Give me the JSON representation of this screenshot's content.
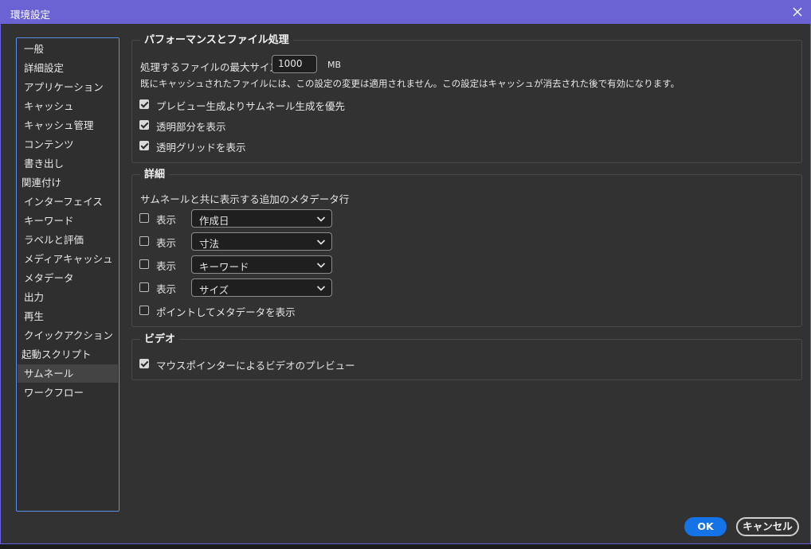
{
  "window": {
    "title": "環境設定"
  },
  "sidebar": {
    "items": [
      {
        "label": "一般"
      },
      {
        "label": "詳細設定"
      },
      {
        "label": "アプリケーション"
      },
      {
        "label": "キャッシュ"
      },
      {
        "label": "キャッシュ管理"
      },
      {
        "label": "コンテンツ"
      },
      {
        "label": "書き出し"
      },
      {
        "label": "関連付け"
      },
      {
        "label": "インターフェイス"
      },
      {
        "label": "キーワード"
      },
      {
        "label": "ラベルと評価"
      },
      {
        "label": "メディアキャッシュ"
      },
      {
        "label": "メタデータ"
      },
      {
        "label": "出力"
      },
      {
        "label": "再生"
      },
      {
        "label": "クイックアクション"
      },
      {
        "label": "起動スクリプト"
      },
      {
        "label": "サムネール"
      },
      {
        "label": "ワークフロー"
      }
    ],
    "selected": "サムネール"
  },
  "performance": {
    "title": "パフォーマンスとファイル処理",
    "max_size_label": "処理するファイルの最大サイズ",
    "max_size_value": "1000",
    "max_size_unit": "MB",
    "note": "既にキャッシュされたファイルには、この設定の変更は適用されません。この設定はキャッシュが消去された後で有効になります。",
    "options": [
      {
        "label": "プレビュー生成よりサムネール生成を優先",
        "checked": true
      },
      {
        "label": "透明部分を表示",
        "checked": true
      },
      {
        "label": "透明グリッドを表示",
        "checked": true
      }
    ]
  },
  "details": {
    "title": "詳細",
    "subtitle": "サムネールと共に表示する追加のメタデータ行",
    "rows": [
      {
        "show_label": "表示",
        "checked": false,
        "selected": "作成日"
      },
      {
        "show_label": "表示",
        "checked": false,
        "selected": "寸法"
      },
      {
        "show_label": "表示",
        "checked": false,
        "selected": "キーワード"
      },
      {
        "show_label": "表示",
        "checked": false,
        "selected": "サイズ"
      }
    ],
    "hover_option": {
      "label": "ポイントしてメタデータを表示",
      "checked": false
    }
  },
  "video": {
    "title": "ビデオ",
    "option": {
      "label": "マウスポインターによるビデオのプレビュー",
      "checked": true
    }
  },
  "buttons": {
    "ok": "OK",
    "cancel": "キャンセル"
  },
  "colors": {
    "accent": "#1473e6",
    "titlebar": "#6b63d3",
    "panel": "#323232",
    "sidebar_border": "#5b8fe0"
  }
}
